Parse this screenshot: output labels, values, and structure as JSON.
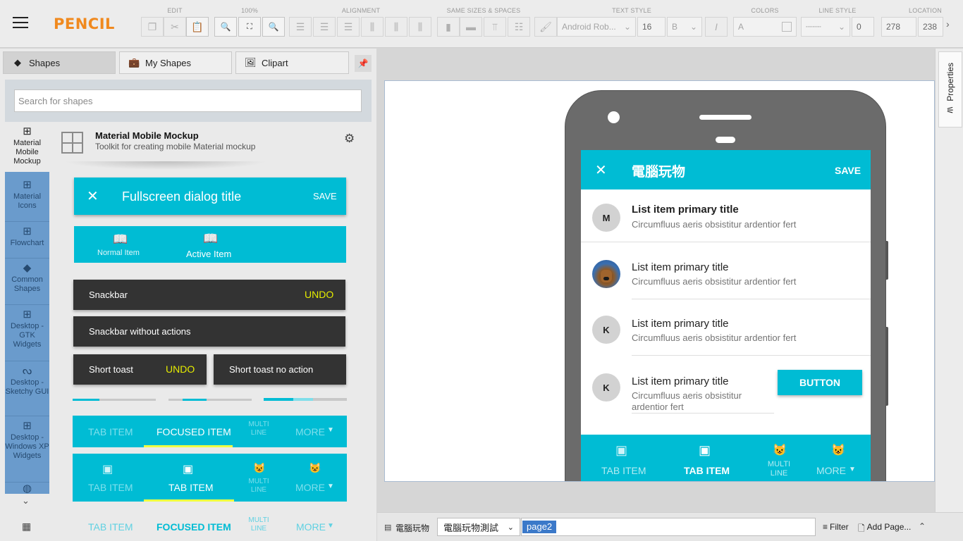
{
  "app": {
    "logo": "PENCIL"
  },
  "toolbar": {
    "groups": {
      "edit": "EDIT",
      "zoom": "100%",
      "alignment": "ALIGNMENT",
      "sizes": "SAME SIZES & SPACES",
      "text_style": "TEXT STYLE",
      "colors": "COLORS",
      "line_style": "LINE STYLE",
      "location": "LOCATION"
    },
    "font_family": "Android Rob...",
    "font_size": "16",
    "color_label": "A",
    "line_width": "0",
    "loc_x": "278",
    "loc_y": "238"
  },
  "left_tabs": {
    "shapes": "Shapes",
    "my_shapes": "My Shapes",
    "clipart": "Clipart"
  },
  "search": {
    "placeholder": "Search for shapes"
  },
  "categories": [
    {
      "label": "Material Mobile Mockup"
    },
    {
      "label": "Material Icons"
    },
    {
      "label": "Flowchart"
    },
    {
      "label": "Common Shapes"
    },
    {
      "label": "Desktop - GTK Widgets"
    },
    {
      "label": "Desktop - Sketchy GUI"
    },
    {
      "label": "Desktop - Windows XP Widgets"
    }
  ],
  "collection": {
    "title": "Material Mobile Mockup",
    "description": "Toolkit for creating mobile Material mockup"
  },
  "stencils": {
    "dialog_title": "Fullscreen dialog title",
    "dialog_save": "SAVE",
    "bn_normal": "Normal Item",
    "bn_active": "Active Item",
    "snackbar": "Snackbar",
    "snackbar_action": "UNDO",
    "snackbar_noaction": "Snackbar without actions",
    "toast": "Short toast",
    "toast_action": "UNDO",
    "toast_noaction": "Short toast no action",
    "tab_item": "TAB ITEM",
    "focused_item": "FOCUSED ITEM",
    "multi_line": "MULTI LINE",
    "more": "MORE"
  },
  "phone": {
    "appbar_title": "電腦玩物",
    "appbar_save": "SAVE",
    "items": [
      {
        "avatar": "M",
        "title": "List item primary title",
        "subtitle": "Circumfluus aeris obsistitur ardentior fert"
      },
      {
        "avatar": "",
        "title": "List item primary title",
        "subtitle": "Circumfluus aeris obsistitur ardentior fert"
      },
      {
        "avatar": "K",
        "title": "List item primary title",
        "subtitle": "Circumfluus aeris obsistitur ardentior fert"
      },
      {
        "avatar": "K",
        "title": "List item primary title",
        "subtitle_1": "Circumfluus aeris obsistitur",
        "subtitle_2": "ardentior fert"
      }
    ],
    "button": "BUTTON",
    "tabs": {
      "tab1": "TAB ITEM",
      "tab2": "TAB ITEM",
      "tab3": "MULTI LINE",
      "tab4": "MORE"
    }
  },
  "properties": {
    "label": "Properties"
  },
  "bottom": {
    "doc_name": "電腦玩物",
    "page_select": "電腦玩物測試",
    "page_tab": "page2",
    "filter": "Filter",
    "add_page": "Add Page..."
  },
  "colors": {
    "accent": "#00bcd4",
    "brand": "#f0891e",
    "snackbar_action": "#e6ed00",
    "tab_indicator": "#eeff41",
    "category_bg": "#6a9bcc"
  }
}
